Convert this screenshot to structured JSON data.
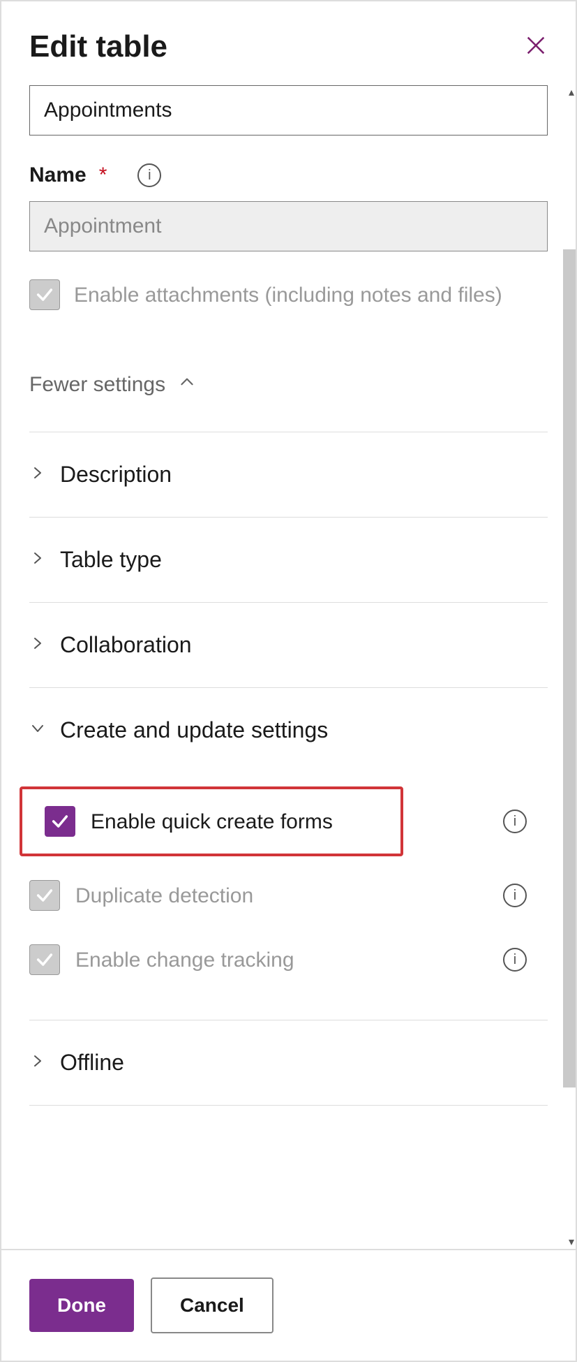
{
  "header": {
    "title": "Edit table"
  },
  "display_name_input": {
    "value": "Appointments"
  },
  "name_field": {
    "label": "Name",
    "value": "Appointment"
  },
  "attachments_checkbox": {
    "label": "Enable attachments (including notes and files)"
  },
  "fewer_settings_label": "Fewer settings",
  "sections": {
    "description": "Description",
    "table_type": "Table type",
    "collaboration": "Collaboration",
    "create_update": "Create and update settings",
    "offline": "Offline"
  },
  "create_update": {
    "quick_create": "Enable quick create forms",
    "duplicate": "Duplicate detection",
    "change_tracking": "Enable change tracking"
  },
  "footer": {
    "done": "Done",
    "cancel": "Cancel"
  }
}
